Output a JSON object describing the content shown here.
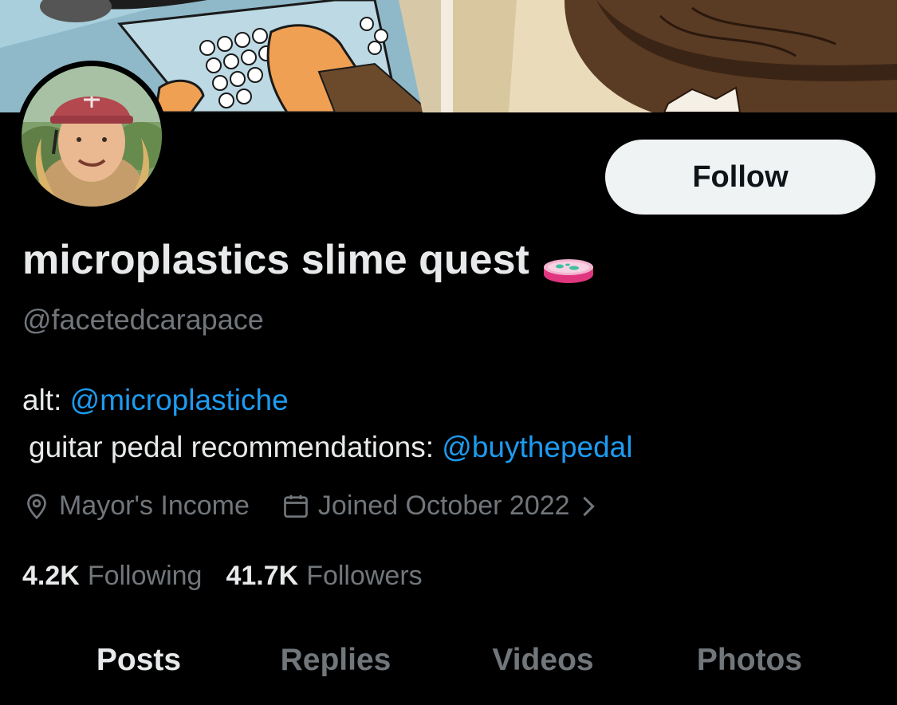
{
  "profile": {
    "display_name": "microplastics slime quest",
    "handle": "@facetedcarapace",
    "badge_icon": "petri-dish-icon"
  },
  "bio": {
    "line1_prefix": "alt: ",
    "line1_mention": "@microplastiche",
    "line2_prefix": "guitar pedal recommendations: ",
    "line2_mention": "@buythepedal"
  },
  "meta": {
    "location": "Mayor's Income",
    "joined": "Joined October 2022"
  },
  "stats": {
    "following_count": "4.2K",
    "following_label": "Following",
    "followers_count": "41.7K",
    "followers_label": "Followers"
  },
  "actions": {
    "follow_label": "Follow"
  },
  "tabs": [
    {
      "label": "Posts",
      "active": true
    },
    {
      "label": "Replies",
      "active": false
    },
    {
      "label": "Videos",
      "active": false
    },
    {
      "label": "Photos",
      "active": false
    }
  ],
  "colors": {
    "background": "#000000",
    "text_primary": "#e7e9ea",
    "text_secondary": "#71767b",
    "link": "#1d9bf0",
    "follow_button_bg": "#eff3f4"
  }
}
